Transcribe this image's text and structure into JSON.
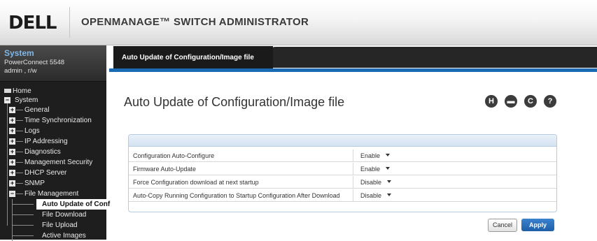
{
  "header": {
    "logo_text": "DELL",
    "app_title": "OPENMANAGE™ SWITCH ADMINISTRATOR"
  },
  "system": {
    "title": "System",
    "device": "PowerConnect 5548",
    "user": "admin , r/w"
  },
  "nav": {
    "home": "Home",
    "system": "System",
    "items": [
      {
        "label": "General",
        "toggle": "+"
      },
      {
        "label": "Time Synchronization",
        "toggle": "+"
      },
      {
        "label": "Logs",
        "toggle": "+"
      },
      {
        "label": "IP Addressing",
        "toggle": "+"
      },
      {
        "label": "Diagnostics",
        "toggle": "+"
      },
      {
        "label": "Management Security",
        "toggle": "+"
      },
      {
        "label": "DHCP Server",
        "toggle": "+"
      },
      {
        "label": "SNMP",
        "toggle": "+"
      },
      {
        "label": "File Management",
        "toggle": "−"
      }
    ],
    "sub_items": [
      {
        "label": "Auto Update of Conf"
      },
      {
        "label": "File Download"
      },
      {
        "label": "File Upload"
      },
      {
        "label": "Active Images"
      }
    ]
  },
  "tab": {
    "label": "Auto Update of Configuration/Image file"
  },
  "page": {
    "title": "Auto Update of Configuration/Image file",
    "icons": [
      {
        "name": "save-icon",
        "glyph": "H"
      },
      {
        "name": "print-icon",
        "glyph": "▬"
      },
      {
        "name": "refresh-icon",
        "glyph": "C"
      },
      {
        "name": "help-icon",
        "glyph": "?"
      }
    ]
  },
  "settings": [
    {
      "label": "Configuration Auto-Configure",
      "value": "Enable"
    },
    {
      "label": "Firmware Auto-Update",
      "value": "Enable"
    },
    {
      "label": "Force Configuration download at next startup",
      "value": "Disable"
    },
    {
      "label": "Auto-Copy Running Configuration to Startup Configuration After Download",
      "value": "Disable"
    }
  ],
  "buttons": {
    "cancel": "Cancel",
    "apply": "Apply"
  },
  "colors": {
    "accent": "#1b6bb4",
    "sidebar_bg": "#1e1e1e",
    "system_title": "#7fb8e8",
    "apply_button": "#2a6dbd"
  }
}
